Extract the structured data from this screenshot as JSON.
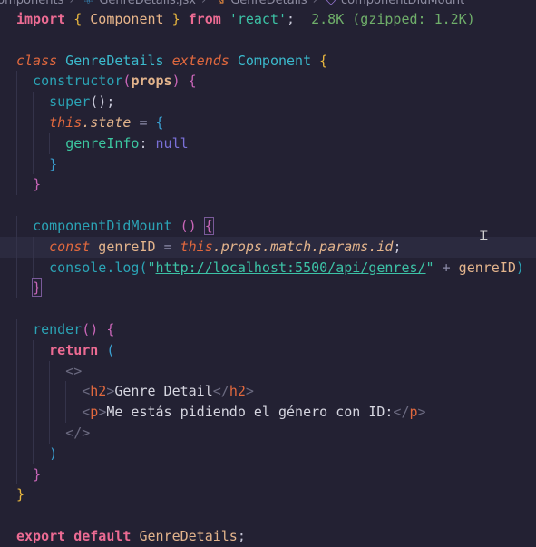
{
  "breadcrumb": [
    "components",
    "GenreDetails.jsx",
    "GenreDetails",
    "componentDidMount"
  ],
  "current_line": 11,
  "code": {
    "lines": [
      {
        "tokens": [
          [
            "import",
            "kw"
          ],
          [
            " ",
            ""
          ],
          [
            "{",
            "br"
          ],
          [
            " Component ",
            "imp"
          ],
          [
            "}",
            "br"
          ],
          [
            " ",
            ""
          ],
          [
            "from",
            "kw"
          ],
          [
            " ",
            ""
          ],
          [
            "'react'",
            "str"
          ],
          [
            ";",
            "pun"
          ],
          [
            "  2.8K (gzipped: 1.2K)",
            "hint"
          ]
        ]
      },
      {
        "tokens": []
      },
      {
        "tokens": [
          [
            "class",
            "it"
          ],
          [
            " GenreDetails ",
            "cls"
          ],
          [
            "extends",
            "it"
          ],
          [
            " Component ",
            "cls"
          ],
          [
            "{",
            "br"
          ]
        ]
      },
      {
        "tokens": [
          [
            "  ",
            ""
          ],
          [
            "constructor",
            "fn"
          ],
          [
            "(",
            "br2"
          ],
          [
            "props",
            "par"
          ],
          [
            ")",
            "br2"
          ],
          [
            " ",
            ""
          ],
          [
            "{",
            "br2"
          ]
        ]
      },
      {
        "tokens": [
          [
            "    ",
            ""
          ],
          [
            "super",
            "fn"
          ],
          [
            "();",
            "pun"
          ]
        ]
      },
      {
        "tokens": [
          [
            "    ",
            ""
          ],
          [
            "this",
            "it"
          ],
          [
            ".state",
            "prop"
          ],
          [
            " = ",
            "op"
          ],
          [
            "{",
            "br3"
          ]
        ]
      },
      {
        "tokens": [
          [
            "      ",
            ""
          ],
          [
            "genreInfo",
            "prop2"
          ],
          [
            ": ",
            "pun"
          ],
          [
            "null",
            "nul"
          ]
        ]
      },
      {
        "tokens": [
          [
            "    ",
            ""
          ],
          [
            "}",
            "br3"
          ]
        ]
      },
      {
        "tokens": [
          [
            "  ",
            ""
          ],
          [
            "}",
            "br2"
          ]
        ]
      },
      {
        "tokens": []
      },
      {
        "tokens": [
          [
            "  ",
            ""
          ],
          [
            "componentDidMount",
            "fn"
          ],
          [
            " ",
            ""
          ],
          [
            "()",
            "br2"
          ],
          [
            " ",
            ""
          ],
          [
            "{",
            "br2 matchbox"
          ]
        ]
      },
      {
        "tokens": [
          [
            "    ",
            ""
          ],
          [
            "const",
            "it"
          ],
          [
            " genreID ",
            "var"
          ],
          [
            "= ",
            "op"
          ],
          [
            "this",
            "it"
          ],
          [
            ".props.match.params.id",
            "prop"
          ],
          [
            ";",
            "pun"
          ]
        ]
      },
      {
        "tokens": [
          [
            "    ",
            ""
          ],
          [
            "console",
            "fn"
          ],
          [
            ".log(",
            "fn"
          ],
          [
            "\"",
            "str"
          ],
          [
            "http://localhost:5500/api/genres/",
            "url"
          ],
          [
            "\"",
            "str"
          ],
          [
            " + ",
            "op"
          ],
          [
            "genreID",
            "var"
          ],
          [
            ")",
            "fn"
          ]
        ]
      },
      {
        "tokens": [
          [
            "  ",
            ""
          ],
          [
            "}",
            "br2 matchbox"
          ]
        ]
      },
      {
        "tokens": []
      },
      {
        "tokens": [
          [
            "  ",
            ""
          ],
          [
            "render",
            "fn"
          ],
          [
            "()",
            "br2"
          ],
          [
            " ",
            ""
          ],
          [
            "{",
            "br2"
          ]
        ]
      },
      {
        "tokens": [
          [
            "    ",
            ""
          ],
          [
            "return",
            "kw"
          ],
          [
            " ",
            ""
          ],
          [
            "(",
            "br3"
          ]
        ]
      },
      {
        "tokens": [
          [
            "      ",
            ""
          ],
          [
            "<>",
            "tag"
          ]
        ]
      },
      {
        "tokens": [
          [
            "        ",
            ""
          ],
          [
            "<",
            "tag"
          ],
          [
            "h2",
            "tn"
          ],
          [
            ">",
            "tag"
          ],
          [
            "Genre Detail",
            "txt"
          ],
          [
            "</",
            "tag"
          ],
          [
            "h2",
            "tn"
          ],
          [
            ">",
            "tag"
          ]
        ]
      },
      {
        "tokens": [
          [
            "        ",
            ""
          ],
          [
            "<",
            "tag"
          ],
          [
            "p",
            "tn"
          ],
          [
            ">",
            "tag"
          ],
          [
            "Me estás pidiendo el género con ID:",
            "txt"
          ],
          [
            "</",
            "tag"
          ],
          [
            "p",
            "tn"
          ],
          [
            ">",
            "tag"
          ]
        ]
      },
      {
        "tokens": [
          [
            "      ",
            ""
          ],
          [
            "</>",
            "tag"
          ]
        ]
      },
      {
        "tokens": [
          [
            "    ",
            ""
          ],
          [
            ")",
            "br3"
          ]
        ]
      },
      {
        "tokens": [
          [
            "  ",
            ""
          ],
          [
            "}",
            "br2"
          ]
        ]
      },
      {
        "tokens": [
          [
            "}",
            "br"
          ]
        ]
      },
      {
        "tokens": []
      },
      {
        "tokens": [
          [
            "export",
            "kw"
          ],
          [
            " ",
            ""
          ],
          [
            "default",
            "kw"
          ],
          [
            " GenreDetails",
            "var"
          ],
          [
            ";",
            "pun"
          ]
        ]
      }
    ]
  }
}
